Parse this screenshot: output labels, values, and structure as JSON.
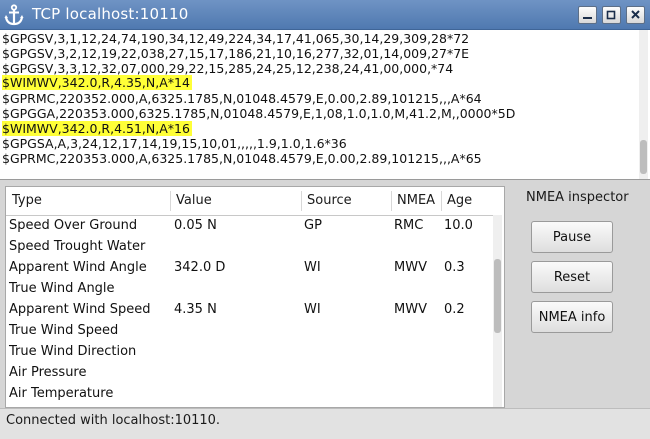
{
  "window": {
    "title": "TCP localhost:10110",
    "controls": [
      "minimize-icon",
      "maximize-icon",
      "close-icon"
    ]
  },
  "log": {
    "lines": [
      {
        "text": "$GPGSV,3,1,12,24,74,190,34,12,49,224,34,17,41,065,30,14,29,309,28*72",
        "highlight": false
      },
      {
        "text": "$GPGSV,3,2,12,19,22,038,27,15,17,186,21,10,16,277,32,01,14,009,27*7E",
        "highlight": false
      },
      {
        "text": "$GPGSV,3,3,12,32,07,000,29,22,15,285,24,25,12,238,24,41,00,000,*74",
        "highlight": false
      },
      {
        "text": "$WIMWV,342.0,R,4.35,N,A*14",
        "highlight": true
      },
      {
        "text": "$GPRMC,220352.000,A,6325.1785,N,01048.4579,E,0.00,2.89,101215,,,A*64",
        "highlight": false
      },
      {
        "text": "$GPGGA,220353.000,6325.1785,N,01048.4579,E,1,08,1.0,1.0,M,41.2,M,,0000*5D",
        "highlight": false
      },
      {
        "text": "$WIMWV,342.0,R,4.51,N,A*16",
        "highlight": true
      },
      {
        "text": "$GPGSA,A,3,24,12,17,14,19,15,10,01,,,,,1.9,1.0,1.6*36",
        "highlight": false
      },
      {
        "text": "$GPRMC,220353.000,A,6325.1785,N,01048.4579,E,0.00,2.89,101215,,,A*65",
        "highlight": false
      }
    ],
    "highlight_color": "#ffff37"
  },
  "table": {
    "columns": [
      "Type",
      "Value",
      "Source",
      "NMEA",
      "Age"
    ],
    "rows": [
      {
        "type": "Speed Over Ground",
        "value": "0.05 N",
        "source": "GP",
        "nmea": "RMC",
        "age": "10.0"
      },
      {
        "type": "Speed Trought Water",
        "value": "",
        "source": "",
        "nmea": "",
        "age": ""
      },
      {
        "type": "Apparent Wind Angle",
        "value": "342.0 D",
        "source": "WI",
        "nmea": "MWV",
        "age": "0.3"
      },
      {
        "type": "True Wind Angle",
        "value": "",
        "source": "",
        "nmea": "",
        "age": ""
      },
      {
        "type": "Apparent Wind Speed",
        "value": "4.35 N",
        "source": "WI",
        "nmea": "MWV",
        "age": "0.2"
      },
      {
        "type": "True Wind Speed",
        "value": "",
        "source": "",
        "nmea": "",
        "age": ""
      },
      {
        "type": "True Wind Direction",
        "value": "",
        "source": "",
        "nmea": "",
        "age": ""
      },
      {
        "type": "Air Pressure",
        "value": "",
        "source": "",
        "nmea": "",
        "age": ""
      },
      {
        "type": "Air Temperature",
        "value": "",
        "source": "",
        "nmea": "",
        "age": ""
      }
    ]
  },
  "inspector": {
    "title": "NMEA inspector",
    "pause_label": "Pause",
    "reset_label": "Reset",
    "info_label": "NMEA info"
  },
  "status": {
    "text": "Connected with localhost:10110."
  },
  "colors": {
    "titlebar": "#5a82b8",
    "highlight": "#ffff37"
  }
}
